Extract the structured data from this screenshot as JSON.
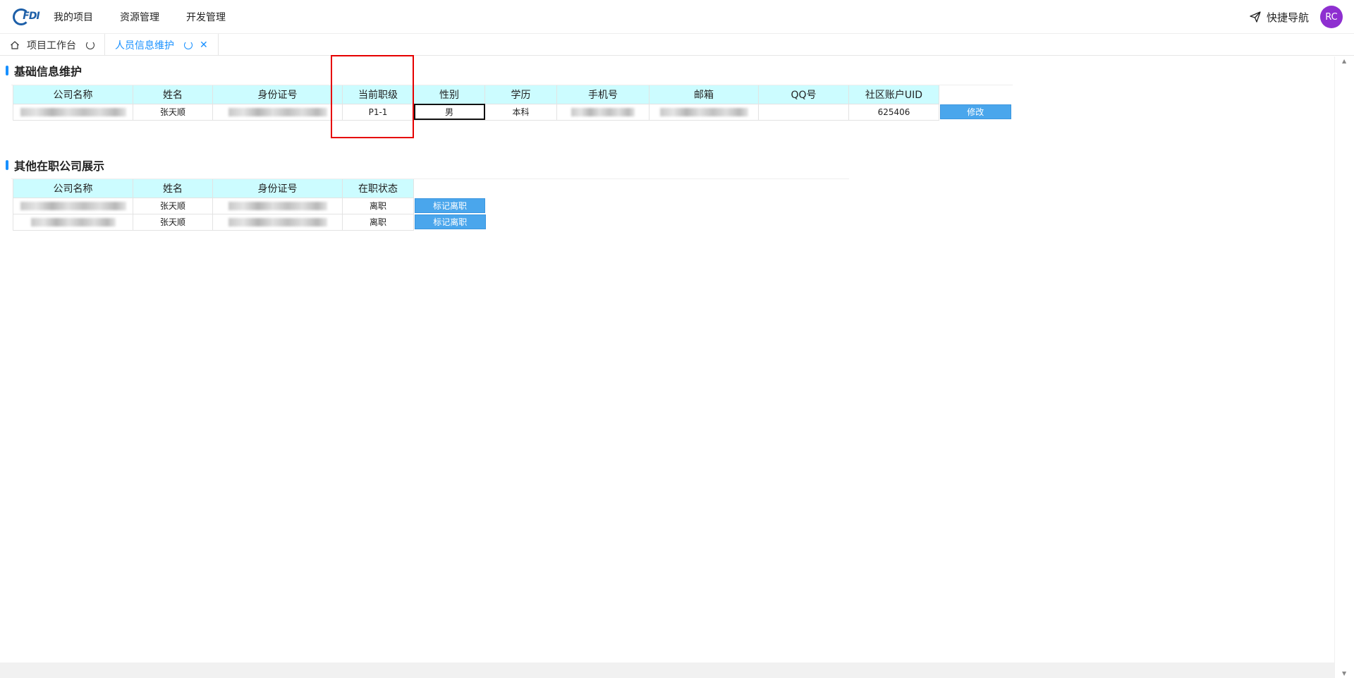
{
  "nav": {
    "logo_text": "FDI",
    "menu": [
      "我的项目",
      "资源管理",
      "开发管理"
    ],
    "quick_nav": "快捷导航",
    "avatar": "RC",
    "avatar_color": "#8e2fd0"
  },
  "tabs": [
    {
      "label": "项目工作台",
      "active": false
    },
    {
      "label": "人员信息维护",
      "active": true
    }
  ],
  "section1": {
    "title": "基础信息维护",
    "headers": [
      "公司名称",
      "姓名",
      "身份证号",
      "当前职级",
      "性别",
      "学历",
      "手机号",
      "邮箱",
      "QQ号",
      "社区账户UID"
    ],
    "row": {
      "name": "张天顺",
      "level": "P1-1",
      "gender": "男",
      "education": "本科",
      "qq": "",
      "uid": "625406"
    },
    "action": "修改"
  },
  "section2": {
    "title": "其他在职公司展示",
    "headers": [
      "公司名称",
      "姓名",
      "身份证号",
      "在职状态"
    ],
    "rows": [
      {
        "name": "张天顺",
        "status": "离职",
        "action": "标记离职"
      },
      {
        "name": "张天顺",
        "status": "离职",
        "action": "标记离职"
      }
    ]
  },
  "colors": {
    "accent": "#1890ff",
    "header_bg": "#ccfcff",
    "button": "#4aa6ec",
    "highlight": "#e60000"
  }
}
